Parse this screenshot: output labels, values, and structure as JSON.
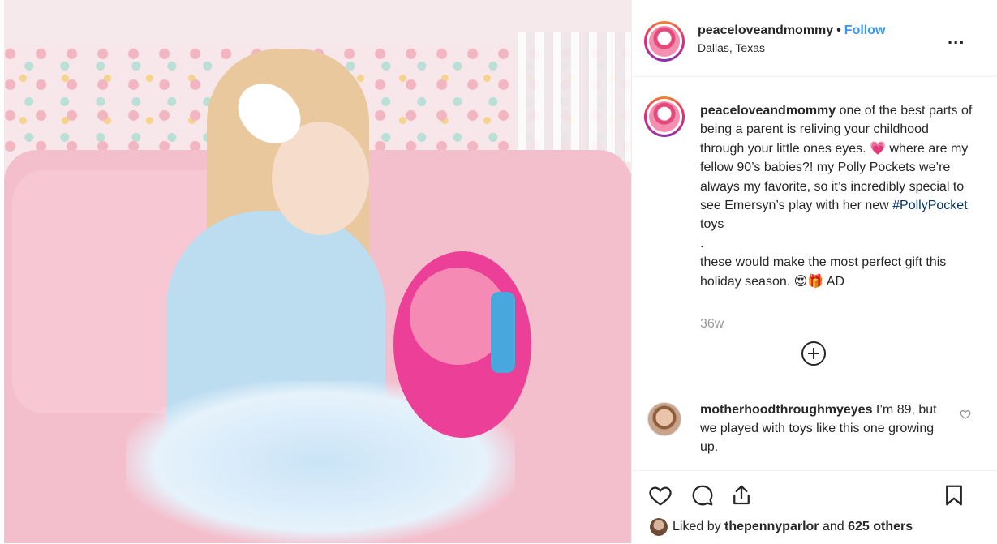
{
  "post": {
    "header": {
      "username": "peaceloveandmommy",
      "separator": "•",
      "follow_label": "Follow",
      "location": "Dallas, Texas",
      "more_label": "..."
    },
    "caption": {
      "username": "peaceloveandmommy",
      "text_part1": " one of the best parts of being a parent is reliving your childhood through your little ones eyes. 💗  where are my fellow 90’s babies?! my Polly Pockets we’re always my favorite, so it’s incredibly special to see Emersyn’s play with her new ",
      "hashtag": "#PollyPocket",
      "text_part2": " toys\n.\nthese would make the most perfect gift this holiday season. 😍🎁  AD",
      "time": "36w"
    },
    "comment": {
      "username": "motherhoodthroughmyeyes",
      "text": " I’m 89, but we played with toys like this one growing up."
    },
    "likes": {
      "prefix": "Liked by ",
      "user": "thepennyparlor",
      "mid": " and ",
      "count": "625 others"
    },
    "icons": {
      "like": "heart-icon",
      "comment": "comment-icon",
      "share": "share-icon",
      "save": "bookmark-icon",
      "load_more": "plus-circle-icon"
    }
  }
}
